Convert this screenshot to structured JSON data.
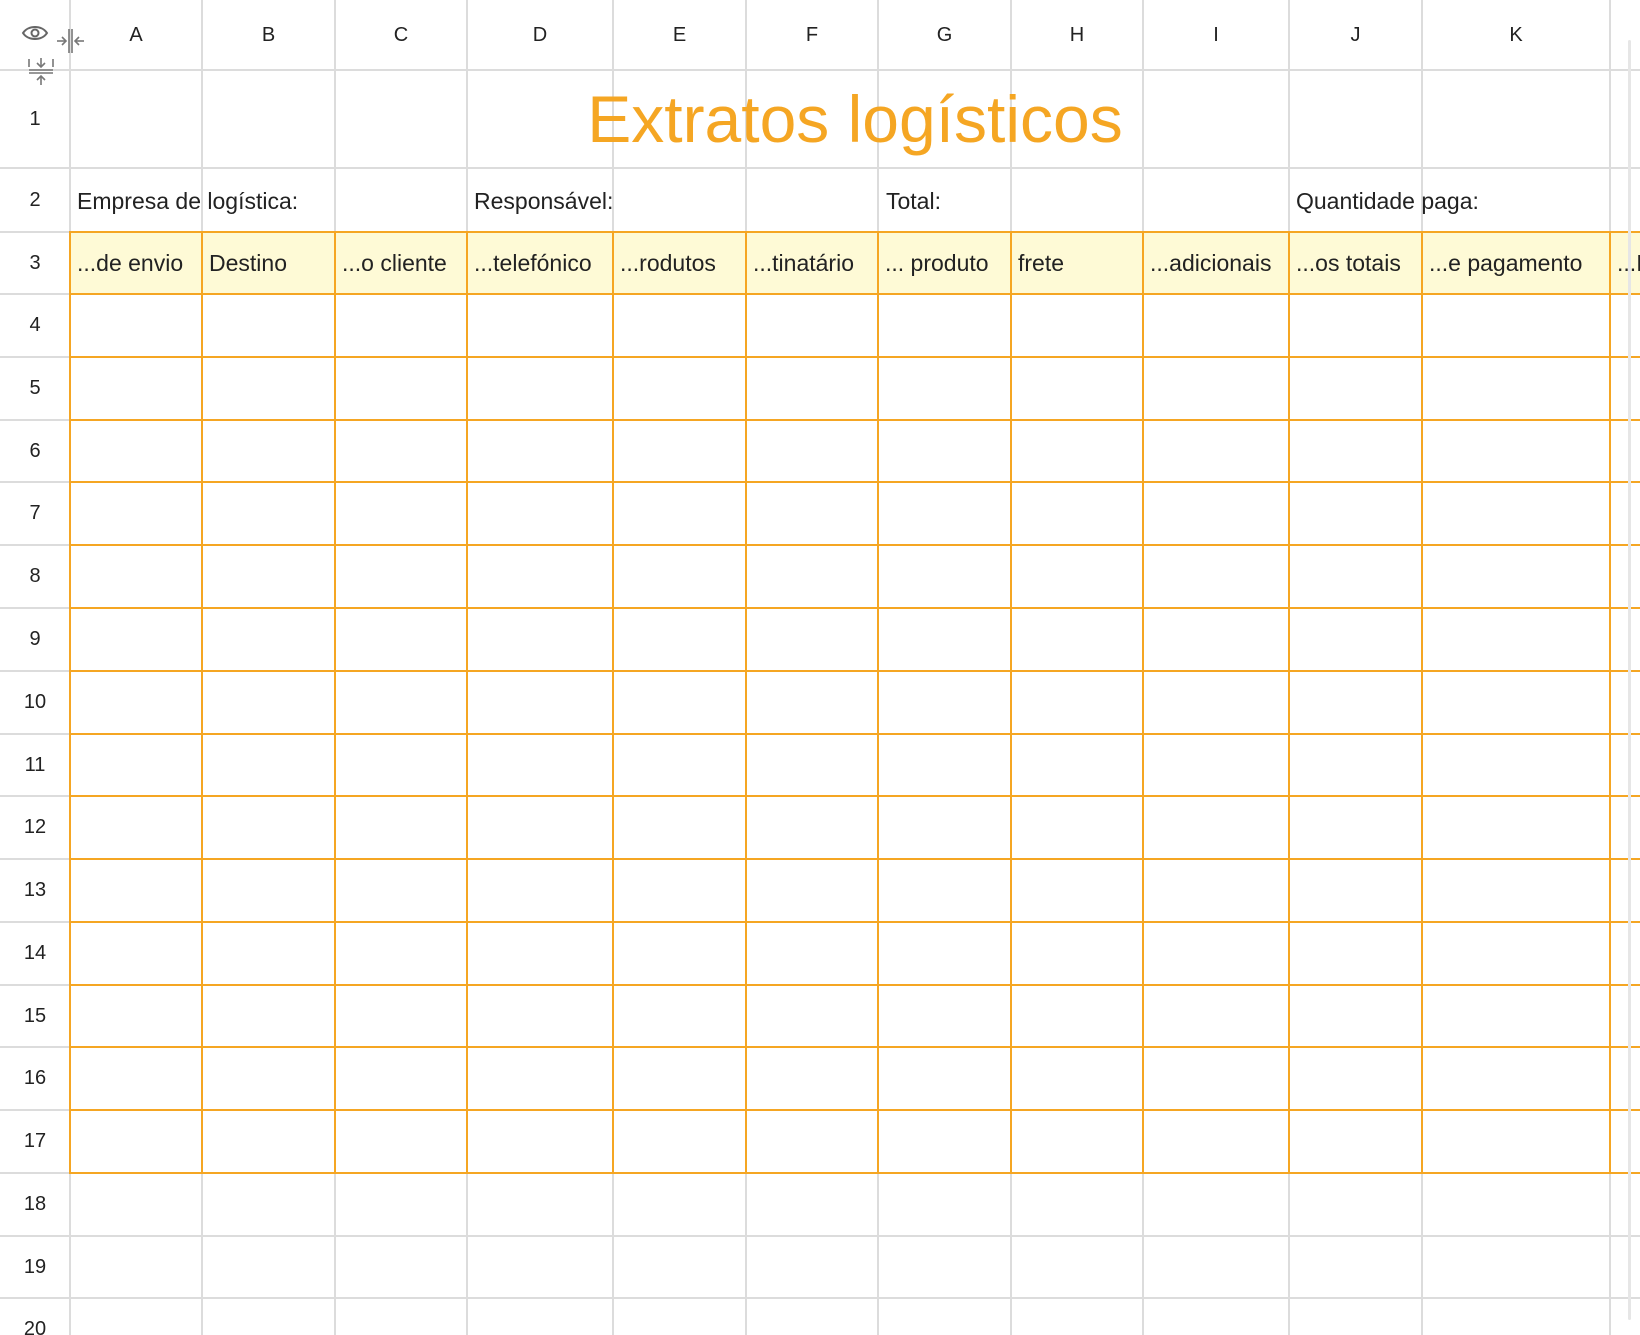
{
  "sheet": {
    "title": "Extratos logísticos",
    "columns": [
      "A",
      "B",
      "C",
      "D",
      "E",
      "F",
      "G",
      "H",
      "I",
      "J",
      "K"
    ],
    "rows": [
      "1",
      "2",
      "3",
      "4",
      "5",
      "6",
      "7",
      "8",
      "9",
      "10",
      "11",
      "12",
      "13",
      "14",
      "15",
      "16",
      "17",
      "18",
      "19",
      "20"
    ],
    "info_labels": {
      "company": "Empresa de logística:",
      "responsible": "Responsável:",
      "total": "Total:",
      "amount_paid": "Quantidade paga:"
    },
    "table_headers": [
      "...de envio",
      "Destino",
      "...o cliente",
      "...telefónico",
      "...rodutos",
      "...tinatário",
      "... produto",
      "frete",
      "...adicionais",
      "...os totais",
      "...e pagamento",
      "...I"
    ],
    "colors": {
      "accent": "#f5a623",
      "header_fill": "#fefad6",
      "gridline": "#dcdcdc"
    }
  },
  "controls": {
    "visibility": "eye-icon",
    "column_collapse": "collapse-columns-icon",
    "row_collapse": "collapse-rows-icon"
  }
}
